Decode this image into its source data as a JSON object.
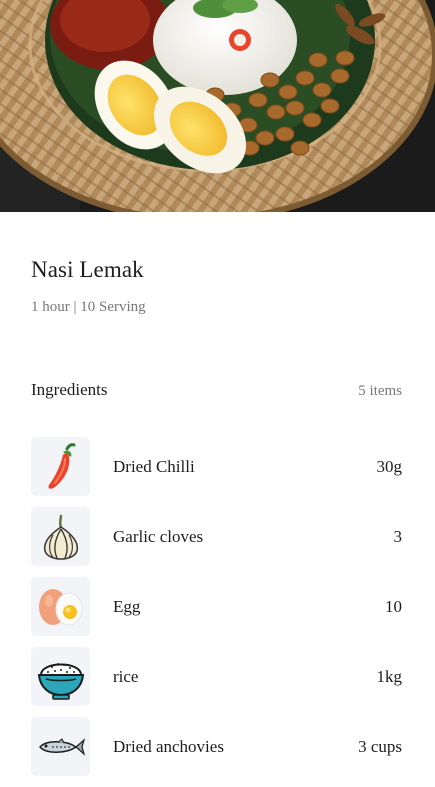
{
  "recipe": {
    "hero_image": "nasi-lemak-photo",
    "title": "Nasi Lemak",
    "meta": "1 hour | 10 Serving"
  },
  "ingredients_section": {
    "title": "Ingredients",
    "count": "5 items"
  },
  "ingredients": [
    {
      "name": "Dried Chilli",
      "quantity": "30g",
      "icon": "chilli-icon"
    },
    {
      "name": "Garlic cloves",
      "quantity": "3",
      "icon": "garlic-icon"
    },
    {
      "name": "Egg",
      "quantity": "10",
      "icon": "egg-icon"
    },
    {
      "name": "rice",
      "quantity": "1kg",
      "icon": "rice-bowl-icon"
    },
    {
      "name": "Dried anchovies",
      "quantity": "3 cups",
      "icon": "anchovy-icon"
    }
  ],
  "colors": {
    "thumb_background": "#f3f4f8",
    "meta_text": "#777777",
    "rice_bowl": "#2aa7b8",
    "chilli": "#e8452c"
  }
}
